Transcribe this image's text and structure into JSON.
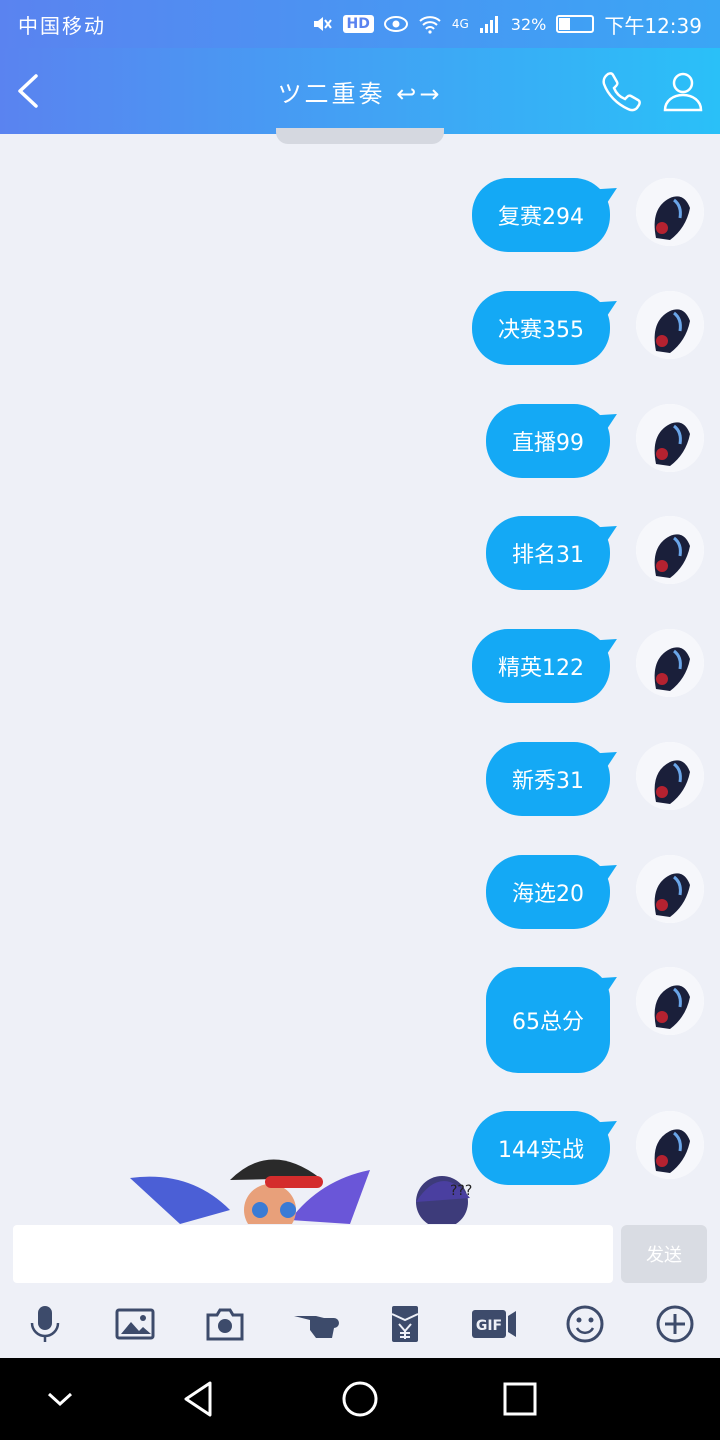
{
  "status_bar": {
    "carrier": "中国移动",
    "network": "4G",
    "battery": "32%",
    "battery_level": 0.32,
    "time": "下午12:39",
    "icons": [
      "mute-icon",
      "hd-icon",
      "eye-icon",
      "wifi-icon",
      "signal-icon",
      "battery-icon"
    ]
  },
  "header": {
    "title": "ツ二重奏",
    "arrow": "↩→",
    "icons": [
      "back-icon",
      "phone-icon",
      "profile-icon"
    ]
  },
  "messages": [
    {
      "text": "复赛294"
    },
    {
      "text": "决赛355"
    },
    {
      "text": "直播99"
    },
    {
      "text": "排名31"
    },
    {
      "text": "精英122"
    },
    {
      "text": "新秀31"
    },
    {
      "text": "海选20"
    },
    {
      "text": "65总分"
    },
    {
      "text": "144实战"
    }
  ],
  "input": {
    "placeholder": "",
    "send_label": "发送"
  },
  "toolbar": {
    "icons": [
      "microphone-icon",
      "image-icon",
      "camera-icon",
      "poke-icon",
      "red-packet-icon",
      "gif-icon",
      "emoji-icon",
      "plus-icon"
    ]
  },
  "system_nav": {
    "icons": [
      "collapse-icon",
      "back-triangle-icon",
      "home-circle-icon",
      "recents-square-icon"
    ]
  },
  "colors": {
    "accent": "#14a9f5",
    "header_start": "#5a83f0",
    "header_end": "#2ac0f8",
    "background": "#eef0f7"
  }
}
